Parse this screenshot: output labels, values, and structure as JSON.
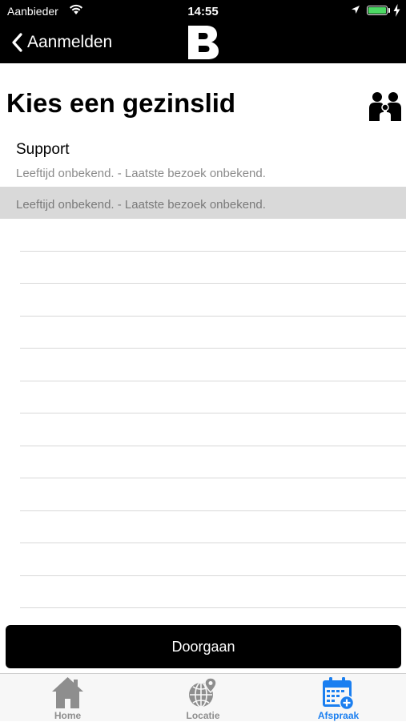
{
  "status_bar": {
    "carrier": "Aanbieder",
    "time": "14:55"
  },
  "nav": {
    "back_label": "Aanmelden",
    "logo_letter": "B"
  },
  "page": {
    "title": "Kies een gezinslid"
  },
  "members": [
    {
      "name": "Support",
      "details": "Leeftijd onbekend. - Laatste bezoek onbekend."
    },
    {
      "name": "",
      "details": "Leeftijd onbekend. - Laatste bezoek onbekend.",
      "selected": true
    }
  ],
  "continue_label": "Doorgaan",
  "tabs": [
    {
      "label": "Home",
      "icon": "home-icon"
    },
    {
      "label": "Locatie",
      "icon": "globe-pin-icon"
    },
    {
      "label": "Afspraak",
      "icon": "calendar-plus-icon",
      "active": true
    }
  ],
  "colors": {
    "accent": "#1b7ff0",
    "bar_background": "#000000",
    "selected_row": "#d9d9d9",
    "battery": "#4cd964"
  }
}
